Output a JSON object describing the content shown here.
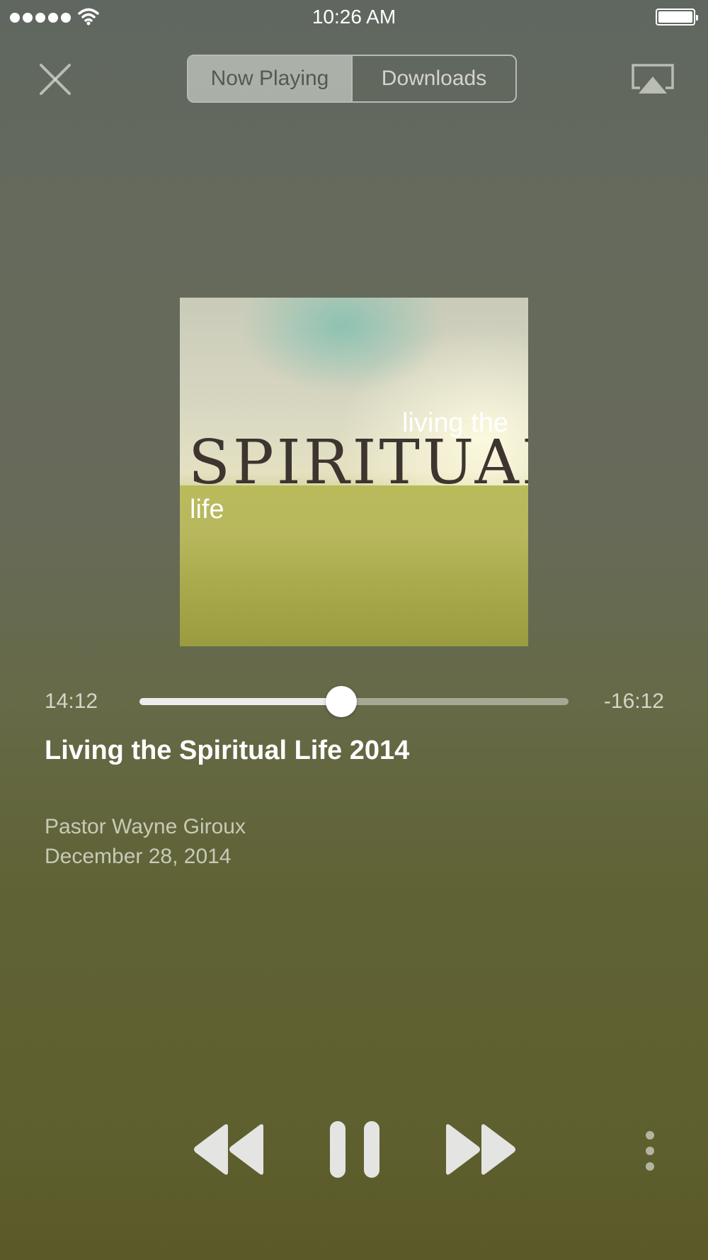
{
  "status_bar": {
    "time": "10:26 AM",
    "signal_icon": "signal-dots-icon",
    "wifi_icon": "wifi-icon",
    "battery_icon": "battery-icon"
  },
  "header": {
    "close_icon": "close-icon",
    "tabs": [
      {
        "label": "Now Playing",
        "active": true
      },
      {
        "label": "Downloads",
        "active": false
      }
    ],
    "airplay_icon": "airplay-icon"
  },
  "artwork": {
    "text_top": "living the",
    "text_main": "SPIRITUAL",
    "text_bottom": "life"
  },
  "progress": {
    "elapsed": "14:12",
    "remaining": "-16:12",
    "fraction": 0.47
  },
  "track": {
    "title": "Living the Spiritual Life 2014",
    "speaker": "Pastor Wayne Giroux",
    "date": "December 28, 2014"
  },
  "controls": {
    "rewind_icon": "rewind-icon",
    "pause_icon": "pause-icon",
    "forward_icon": "fast-forward-icon",
    "more_icon": "more-vertical-icon"
  },
  "colors": {
    "background_top": "#5f6760",
    "background_bottom": "#5a5a28",
    "active_segment": "#c4c8c0",
    "text": "#ffffff"
  }
}
